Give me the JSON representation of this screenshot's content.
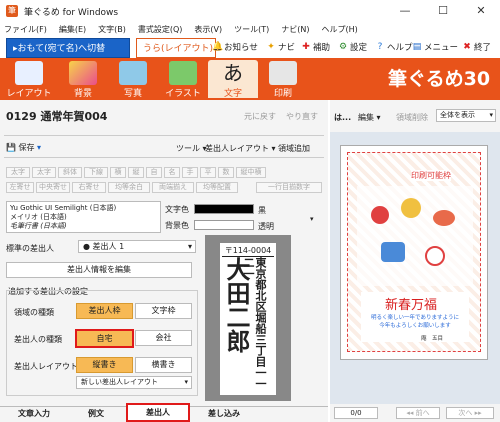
{
  "window": {
    "title": "筆ぐるめ for Windows",
    "app_icon": "筆",
    "min": "—",
    "max": "☐",
    "close": "✕"
  },
  "menu": [
    "ファイル(F)",
    "編集(E)",
    "文字(B)",
    "書式設定(Q)",
    "表示(V)",
    "ツール(T)",
    "ナビ(N)",
    "ヘルプ(H)"
  ],
  "mode": {
    "omote": "▸おもて(宛て名)へ切替",
    "ura": "うら(レイアウト)"
  },
  "top_links": {
    "oshirase": "お知らせ",
    "navi": "ナビ",
    "hojo": "補助",
    "settei": "設定",
    "help": "ヘルプ",
    "menu": "メニュー",
    "end": "終了"
  },
  "ribbon": {
    "items": [
      "レイアウト",
      "背景",
      "写真",
      "イラスト",
      "文字",
      "印刷"
    ],
    "brand": "筆ぐるめ30"
  },
  "doc": {
    "title": "0129 通常年賀004",
    "undo": "元に戻す",
    "redo": "やり直す"
  },
  "toolbar": {
    "save": "保存",
    "tools": "ツール",
    "sender_layout": "差出人レイアウト",
    "region_add": "領域追加"
  },
  "format_row1": [
    "太字",
    "斜体",
    "下線",
    "横",
    "縦",
    "自",
    "名",
    "手",
    "平",
    "数",
    "縦中横"
  ],
  "format_row2": [
    "左寄せ",
    "中央寄せ",
    "右寄せ",
    "均等余白",
    "両端揃え",
    "均等配置",
    "一行目揃数字"
  ],
  "fonts": {
    "items": [
      "Yu Gothic UI Semilight (日本語)",
      "メイリオ (日本語)",
      "毛筆行書 (日本語)"
    ]
  },
  "text_color": {
    "label": "文字色",
    "value": "黒"
  },
  "bg_color": {
    "label": "背景色",
    "value": "透明"
  },
  "standard_sender": {
    "label": "標準の差出人",
    "value": "● 差出人 1"
  },
  "edit_sender": "差出人情報を編集",
  "add_sender_title": "追加する差出人の設定",
  "region_type": {
    "label": "領域の種類",
    "opt1": "差出人枠",
    "opt2": "文字枠"
  },
  "sender_type": {
    "label": "差出人の種類",
    "opt1": "自宅",
    "opt2": "会社"
  },
  "sender_layout": {
    "label": "差出人レイアウト",
    "opt1": "縦書き",
    "opt2": "横書き",
    "select": "新しい差出人レイアウト"
  },
  "preview": {
    "postal": "〒114-0004",
    "address": "東京都北区堀船三丁目一一二一",
    "name": "大田二郎"
  },
  "tabs": [
    "文章入力",
    "例文",
    "差出人",
    "差し込み"
  ],
  "right": {
    "label": "は...",
    "edit": "編集",
    "region_delete": "領域削除",
    "view": "全体を表示",
    "printable": "印刷可能枠",
    "greeting": "新春万福",
    "message": "明るく楽しい一年でありますように\n今年もよろしくお願いします",
    "signature": "庵　五目",
    "page": "0/0",
    "prev": "前へ",
    "next": "次へ"
  }
}
